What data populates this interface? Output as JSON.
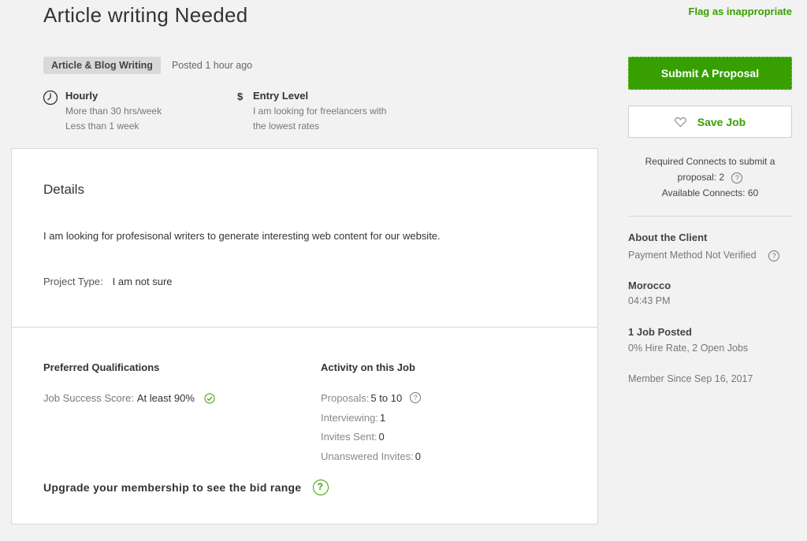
{
  "job": {
    "title": "Article writing Needed",
    "flag_link": "Flag as inappropriate",
    "category_tag": "Article & Blog Writing",
    "posted": "Posted 1 hour ago",
    "hourly": {
      "label": "Hourly",
      "line1": "More than 30 hrs/week",
      "line2": "Less than 1 week"
    },
    "level": {
      "label": "Entry Level",
      "line1": "I am looking for freelancers with",
      "line2": "the lowest rates"
    }
  },
  "details": {
    "heading": "Details",
    "description": "I am looking for profesisonal writers to generate interesting web content for our website.",
    "project_type_key": "Project Type:",
    "project_type_value": "I am not sure"
  },
  "qualifications": {
    "heading": "Preferred Qualifications",
    "jss_key": "Job Success Score:",
    "jss_value": "At least 90%"
  },
  "activity": {
    "heading": "Activity on this Job",
    "proposals_key": "Proposals:",
    "proposals_value": "5 to 10",
    "interviewing_key": "Interviewing:",
    "interviewing_value": "1",
    "invites_key": "Invites Sent:",
    "invites_value": "0",
    "unanswered_key": "Unanswered Invites:",
    "unanswered_value": "0"
  },
  "upgrade_text": "Upgrade your membership to see the bid range",
  "sidebar": {
    "submit_label": "Submit A Proposal",
    "save_label": "Save Job",
    "connects_line1": "Required Connects to submit a",
    "connects_line2": "proposal: 2",
    "connects_line3": "Available Connects: 60",
    "about_heading": "About the Client",
    "payment": "Payment Method Not Verified",
    "country": "Morocco",
    "local_time": "04:43 PM",
    "jobs_posted": "1 Job Posted",
    "hire_rate": "0% Hire Rate, 2 Open Jobs",
    "member_since": "Member Since Sep 16, 2017"
  },
  "colors": {
    "accent_green": "#37a000",
    "background": "#f2f2f2"
  }
}
